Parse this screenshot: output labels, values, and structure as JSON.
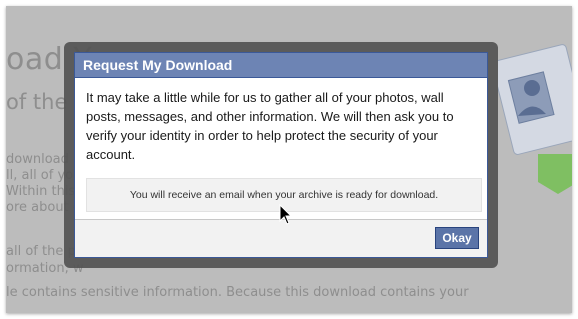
{
  "background": {
    "heading_fragment": "oad Y",
    "subheading_fragment": "of the",
    "left_fragments": [
      "ll, all of yo",
      "Within this a",
      "ore about c"
    ],
    "left_fragment_1": "download",
    "left_fragment_5": "all of the p",
    "left_fragment_6": "ormation, w",
    "bottom_line": "le contains sensitive information. Because this download contains your"
  },
  "dialog": {
    "title": "Request My Download",
    "message": "It may take a little while for us to gather all of your photos, wall posts, messages, and other information. We will then ask you to verify your identity in order to help protect the security of your account.",
    "notice": "You will receive an email when your archive is ready for download.",
    "okay_label": "Okay"
  },
  "colors": {
    "header": "#6d84b4",
    "button": "#5b74a8",
    "overlay": "#525252"
  }
}
